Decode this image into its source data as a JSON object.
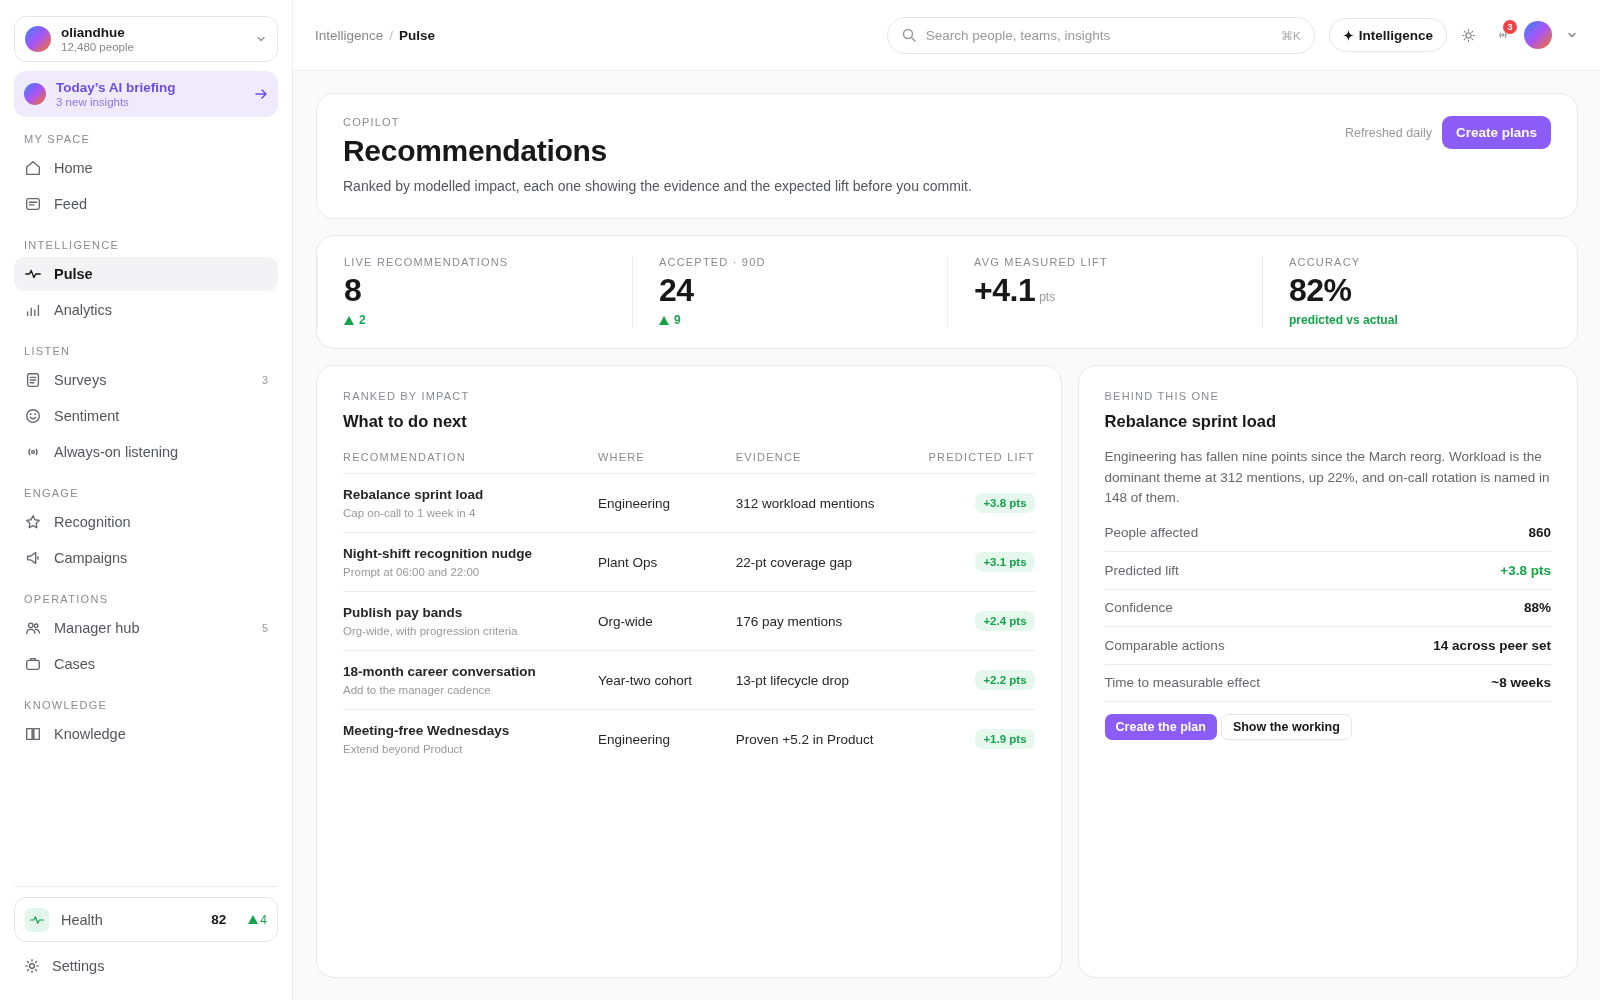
{
  "workspace": {
    "name": "oliandhue",
    "members": "12,480 people"
  },
  "briefing": {
    "title": "Today’s AI briefing",
    "subtitle": "3 new insights"
  },
  "nav_sections": [
    {
      "label": "MY SPACE",
      "items": [
        {
          "label": "Home",
          "selected": false
        },
        {
          "label": "Feed",
          "selected": false
        }
      ]
    },
    {
      "label": "INTELLIGENCE",
      "items": [
        {
          "label": "Pulse",
          "selected": true
        },
        {
          "label": "Analytics",
          "selected": false
        }
      ]
    },
    {
      "label": "LISTEN",
      "items": [
        {
          "label": "Surveys",
          "selected": false,
          "count": "3"
        },
        {
          "label": "Sentiment",
          "selected": false
        },
        {
          "label": "Always-on listening",
          "selected": false
        }
      ]
    },
    {
      "label": "ENGAGE",
      "items": [
        {
          "label": "Recognition",
          "selected": false
        },
        {
          "label": "Campaigns",
          "selected": false
        }
      ]
    },
    {
      "label": "OPERATIONS",
      "items": [
        {
          "label": "Manager hub",
          "selected": false,
          "count": "5"
        },
        {
          "label": "Cases",
          "selected": false
        }
      ]
    },
    {
      "label": "KNOWLEDGE",
      "items": [
        {
          "label": "Knowledge",
          "selected": false
        }
      ]
    }
  ],
  "health": {
    "label": "Health",
    "score": "82",
    "change": "4"
  },
  "settings": {
    "label": "Settings"
  },
  "breadcrumb": [
    "Intelligence",
    "Pulse"
  ],
  "breadcrumb_separator": "/",
  "search": {
    "placeholder": "Search people, teams, insights",
    "shortcut": "⌘K"
  },
  "intelligence_button": "Intelligence",
  "notifications": {
    "count": "3"
  },
  "header": {
    "eyebrow": "COPILOT",
    "title": "Recommendations",
    "description": "Ranked by modelled impact, each one showing the evidence and the expected lift before you commit.",
    "refresh_note": "Refreshed daily",
    "button": "Create plans"
  },
  "stats": [
    {
      "label": "LIVE RECOMMENDATIONS",
      "value": "8",
      "delta": "2"
    },
    {
      "label": "ACCEPTED · 90D",
      "value": "24",
      "delta": "9"
    },
    {
      "label": "AVG MEASURED LIFT",
      "value": "+4.1",
      "unit": "pts"
    },
    {
      "label": "ACCURACY",
      "value": "82%",
      "note": "predicted vs actual"
    }
  ],
  "ranked": {
    "eyebrow": "RANKED BY IMPACT",
    "title": "What to do next",
    "columns": [
      "RECOMMENDATION",
      "WHERE",
      "EVIDENCE",
      "PREDICTED LIFT"
    ],
    "rows": [
      {
        "title": "Rebalance sprint load",
        "subtitle": "Cap on-call to 1 week in 4",
        "where": "Engineering",
        "evidence": "312 workload mentions",
        "lift": "+3.8 pts"
      },
      {
        "title": "Night-shift recognition nudge",
        "subtitle": "Prompt at 06:00 and 22:00",
        "where": "Plant Ops",
        "evidence": "22-pt coverage gap",
        "lift": "+3.1 pts"
      },
      {
        "title": "Publish pay bands",
        "subtitle": "Org-wide, with progression criteria",
        "where": "Org-wide",
        "evidence": "176 pay mentions",
        "lift": "+2.4 pts"
      },
      {
        "title": "18-month career conversation",
        "subtitle": "Add to the manager cadence",
        "where": "Year-two cohort",
        "evidence": "13-pt lifecycle drop",
        "lift": "+2.2 pts"
      },
      {
        "title": "Meeting-free Wednesdays",
        "subtitle": "Extend beyond Product",
        "where": "Engineering",
        "evidence": "Proven +5.2 in Product",
        "lift": "+1.9 pts"
      }
    ]
  },
  "detail": {
    "eyebrow": "BEHIND THIS ONE",
    "title": "Rebalance sprint load",
    "body": "Engineering has fallen nine points since the March reorg. Workload is the dominant theme at 312 mentions, up 22%, and on-call rotation is named in 148 of them.",
    "facts": [
      {
        "label": "People affected",
        "value": "860",
        "kind": "plain"
      },
      {
        "label": "Predicted lift",
        "value": "+3.8 pts",
        "kind": "positive"
      },
      {
        "label": "Confidence",
        "value": "88%",
        "kind": "plain"
      },
      {
        "label": "Comparable actions",
        "value": "14 across peer set",
        "kind": "plain"
      },
      {
        "label": "Time to measurable effect",
        "value": "~8 weeks",
        "kind": "plain"
      }
    ],
    "primary_button": "Create the plan",
    "secondary_button": "Show the working"
  }
}
